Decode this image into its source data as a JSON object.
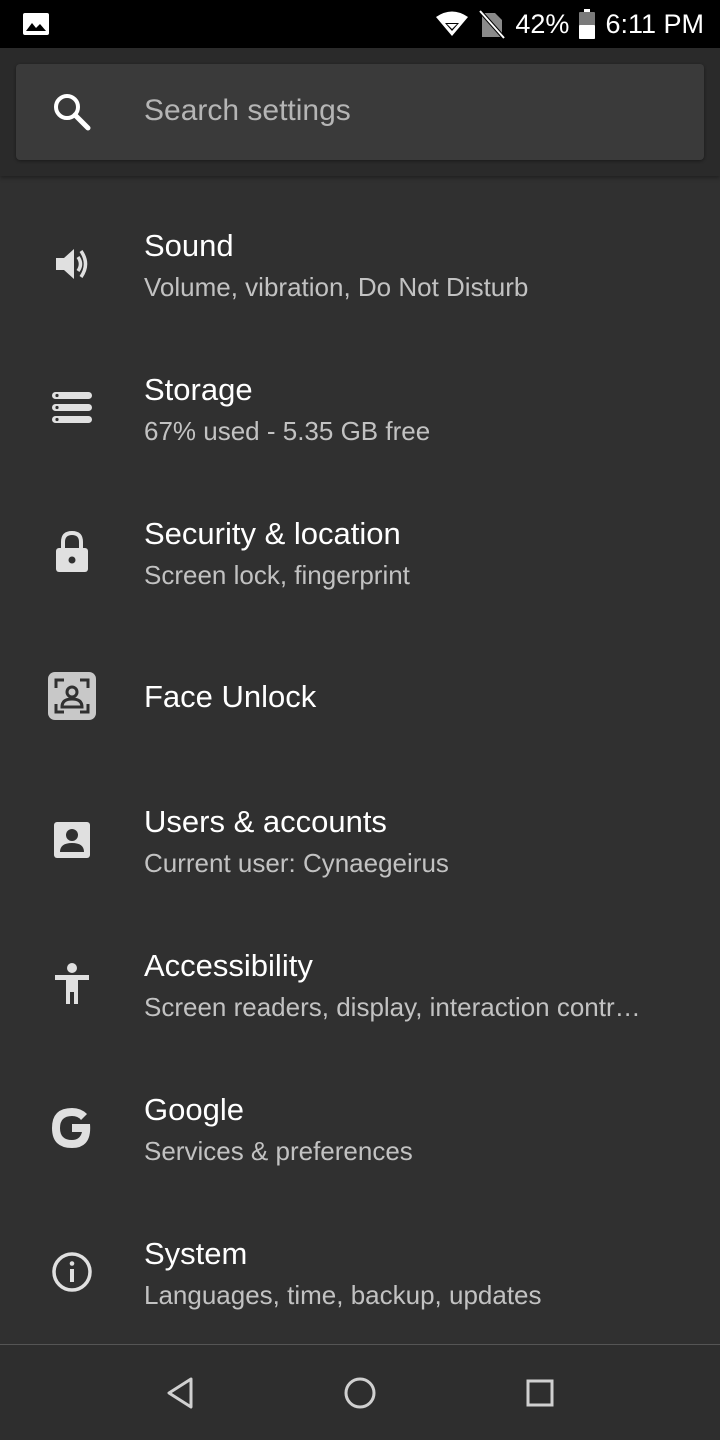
{
  "status_bar": {
    "battery_percent": "42%",
    "time": "6:11 PM",
    "icons": [
      "image-notification-icon",
      "wifi-icon",
      "no-sim-icon",
      "battery-icon"
    ]
  },
  "search": {
    "placeholder": "Search settings",
    "icon": "search-icon"
  },
  "settings": [
    {
      "icon": "volume-icon",
      "title": "Sound",
      "subtitle": "Volume, vibration, Do Not Disturb"
    },
    {
      "icon": "storage-icon",
      "title": "Storage",
      "subtitle": "67% used - 5.35 GB free"
    },
    {
      "icon": "lock-icon",
      "title": "Security & location",
      "subtitle": "Screen lock, fingerprint"
    },
    {
      "icon": "face-unlock-icon",
      "title": "Face Unlock",
      "subtitle": ""
    },
    {
      "icon": "account-box-icon",
      "title": "Users & accounts",
      "subtitle": "Current user: Cynaegeirus"
    },
    {
      "icon": "accessibility-icon",
      "title": "Accessibility",
      "subtitle": "Screen readers, display, interaction contr…"
    },
    {
      "icon": "google-icon",
      "title": "Google",
      "subtitle": "Services & preferences"
    },
    {
      "icon": "info-icon",
      "title": "System",
      "subtitle": "Languages, time, backup, updates"
    }
  ],
  "nav_bar": {
    "buttons": [
      "back-icon",
      "home-icon",
      "recents-icon"
    ]
  },
  "colors": {
    "background": "#303030",
    "status_bar": "#000000",
    "search_box": "#3a3a3a",
    "primary_text": "#ffffff",
    "secondary_text": "#c2c2c2",
    "icon": "#e0e0e0"
  }
}
